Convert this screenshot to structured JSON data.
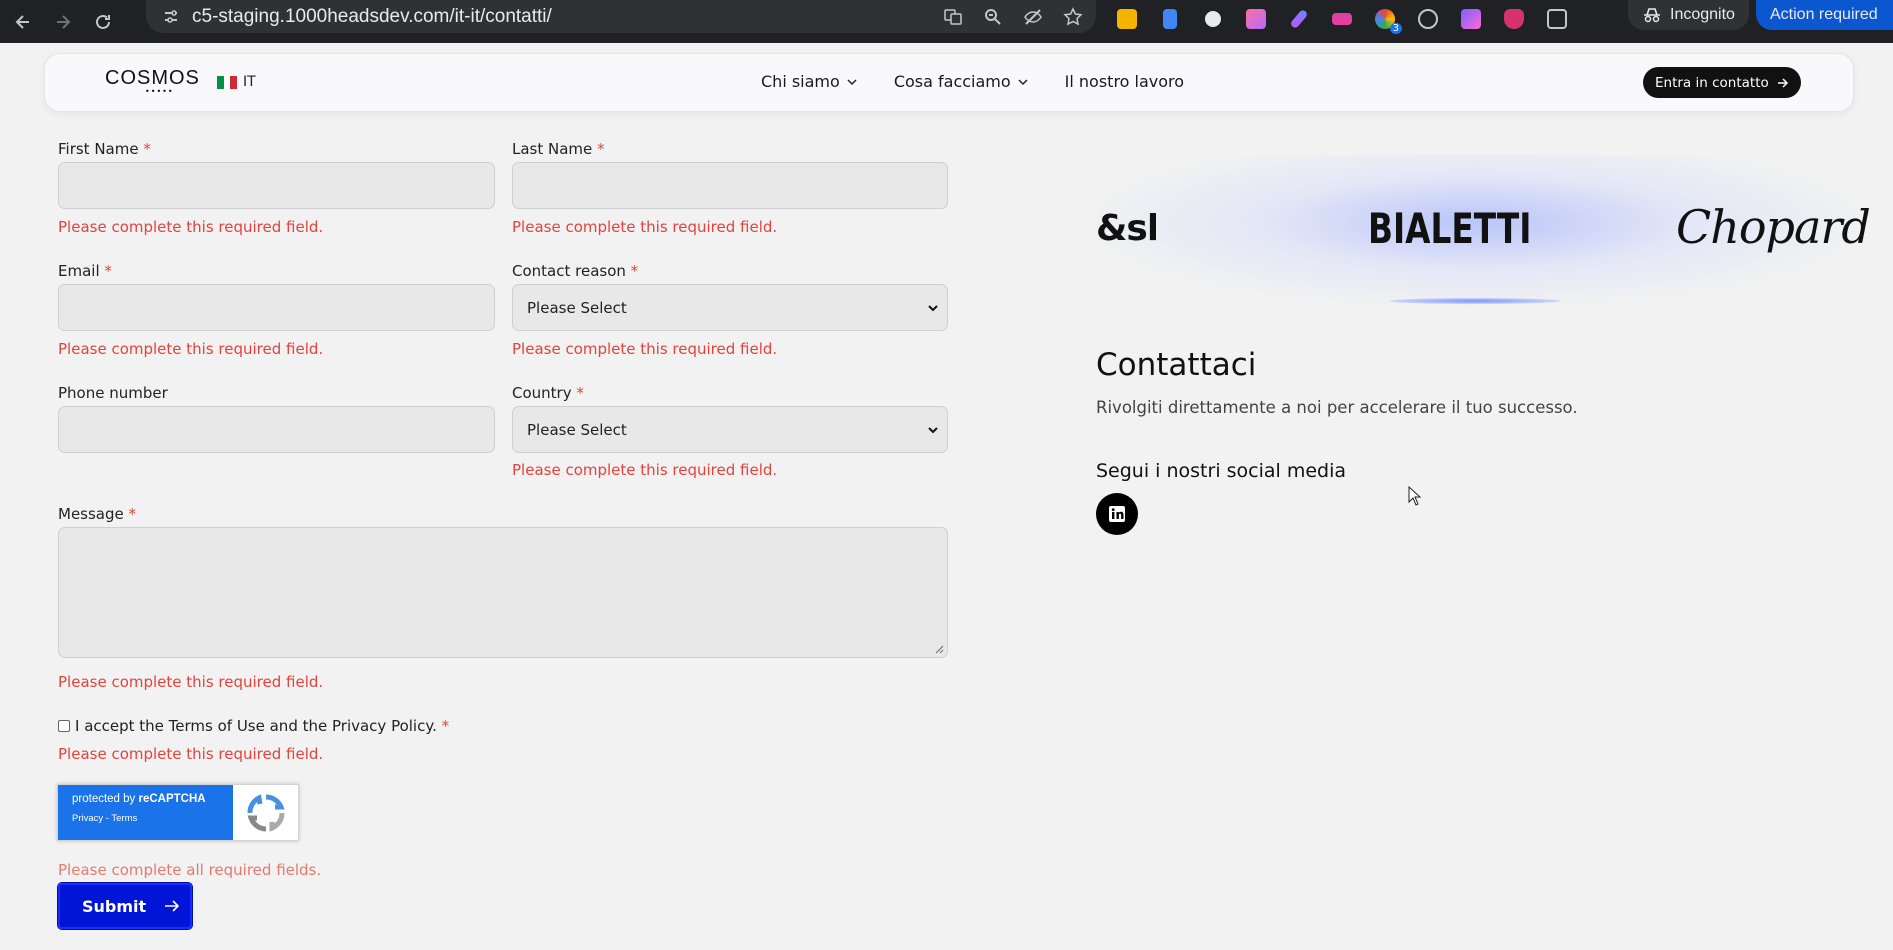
{
  "browser": {
    "url": "c5-staging.1000headsdev.com/it-it/contatti/",
    "incognito_label": "Incognito",
    "action_label": "Action required",
    "extension_badge": "3"
  },
  "header": {
    "logo": "COSMOS",
    "logo_dots": "•••••",
    "language": "IT",
    "nav": [
      {
        "label": "Chi siamo"
      },
      {
        "label": "Cosa facciamo"
      },
      {
        "label": "Il nostro lavoro"
      }
    ],
    "cta_label": "Entra in contatto"
  },
  "form": {
    "required_mark": "*",
    "first_name": {
      "label": "First Name",
      "value": "",
      "error": "Please complete this required field."
    },
    "last_name": {
      "label": "Last Name",
      "value": "",
      "error": "Please complete this required field."
    },
    "email": {
      "label": "Email",
      "value": "",
      "error": "Please complete this required field."
    },
    "contact_reason": {
      "label": "Contact reason",
      "value": "Please Select",
      "error": "Please complete this required field."
    },
    "phone": {
      "label": "Phone number",
      "value": ""
    },
    "country": {
      "label": "Country",
      "value": "Please Select",
      "error": "Please complete this required field."
    },
    "message": {
      "label": "Message",
      "value": "",
      "error": "Please complete this required field."
    },
    "terms": {
      "label": "I accept the Terms of Use and the Privacy Policy.",
      "error": "Please complete this required field."
    },
    "recaptcha": {
      "line1_prefix": "protected by ",
      "line1_brand": "reCAPTCHA",
      "line2": "Privacy - Terms"
    },
    "form_error": "Please complete all required fields.",
    "submit_label": "Submit"
  },
  "right": {
    "brands": [
      "&sh",
      "BIALETTI",
      "Chopard"
    ],
    "contact_title": "Contattaci",
    "contact_subtitle": "Rivolgiti direttamente a noi per accelerare il tuo successo.",
    "social_title": "Segui i nostri social media",
    "social_icons": [
      "linkedin-icon"
    ]
  },
  "colors": {
    "error": "#e5423c",
    "submit": "#0015d6",
    "chrome": "#202124",
    "action": "#0b57d0"
  }
}
